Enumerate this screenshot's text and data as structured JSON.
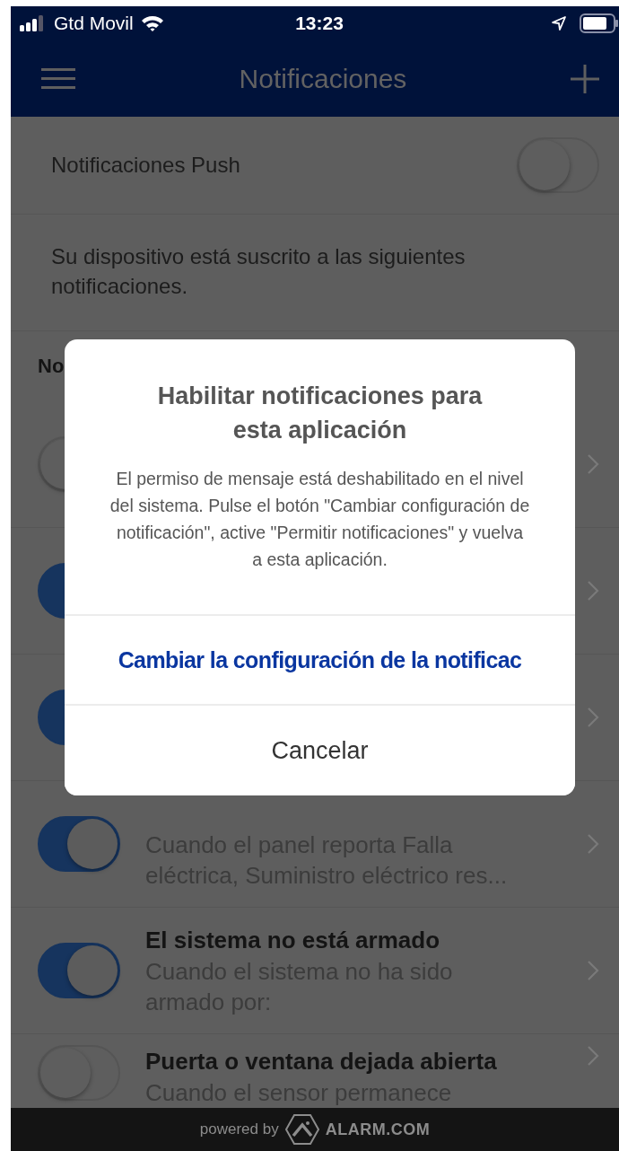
{
  "status_bar": {
    "carrier": "Gtd Movil",
    "time": "13:23"
  },
  "nav_bar": {
    "title": "Notificaciones"
  },
  "push_setting": {
    "label": "Notificaciones Push",
    "on": false
  },
  "description": "Su dispositivo está suscrito a las siguientes notificaciones.",
  "section_header": "No",
  "notification_rows": [
    {
      "on": false
    },
    {
      "on": true
    },
    {
      "on": true
    },
    {
      "on": true,
      "subtitle": "Cuando el panel reporta Falla eléctrica, Suministro eléctrico res..."
    },
    {
      "on": true,
      "title": "El sistema no está armado",
      "subtitle": "Cuando el sistema no ha sido armado por:"
    },
    {
      "on": false,
      "title": "Puerta o ventana dejada abierta",
      "subtitle": "Cuando el sensor permanece"
    }
  ],
  "dialog": {
    "title": "Habilitar notificaciones para esta aplicación",
    "message": "El permiso de mensaje está deshabilitado en el nivel del sistema. Pulse el botón \"Cambiar configuración de notificación\", active \"Permitir notificaciones\" y vuelva a esta aplicación.",
    "buttons": [
      {
        "label": "Cambiar la configuración de la notificac",
        "kind": "primary"
      },
      {
        "label": "Cancelar",
        "kind": "cancel"
      }
    ]
  },
  "footer": {
    "prefix": "powered by",
    "brand": "ALARM.COM"
  }
}
